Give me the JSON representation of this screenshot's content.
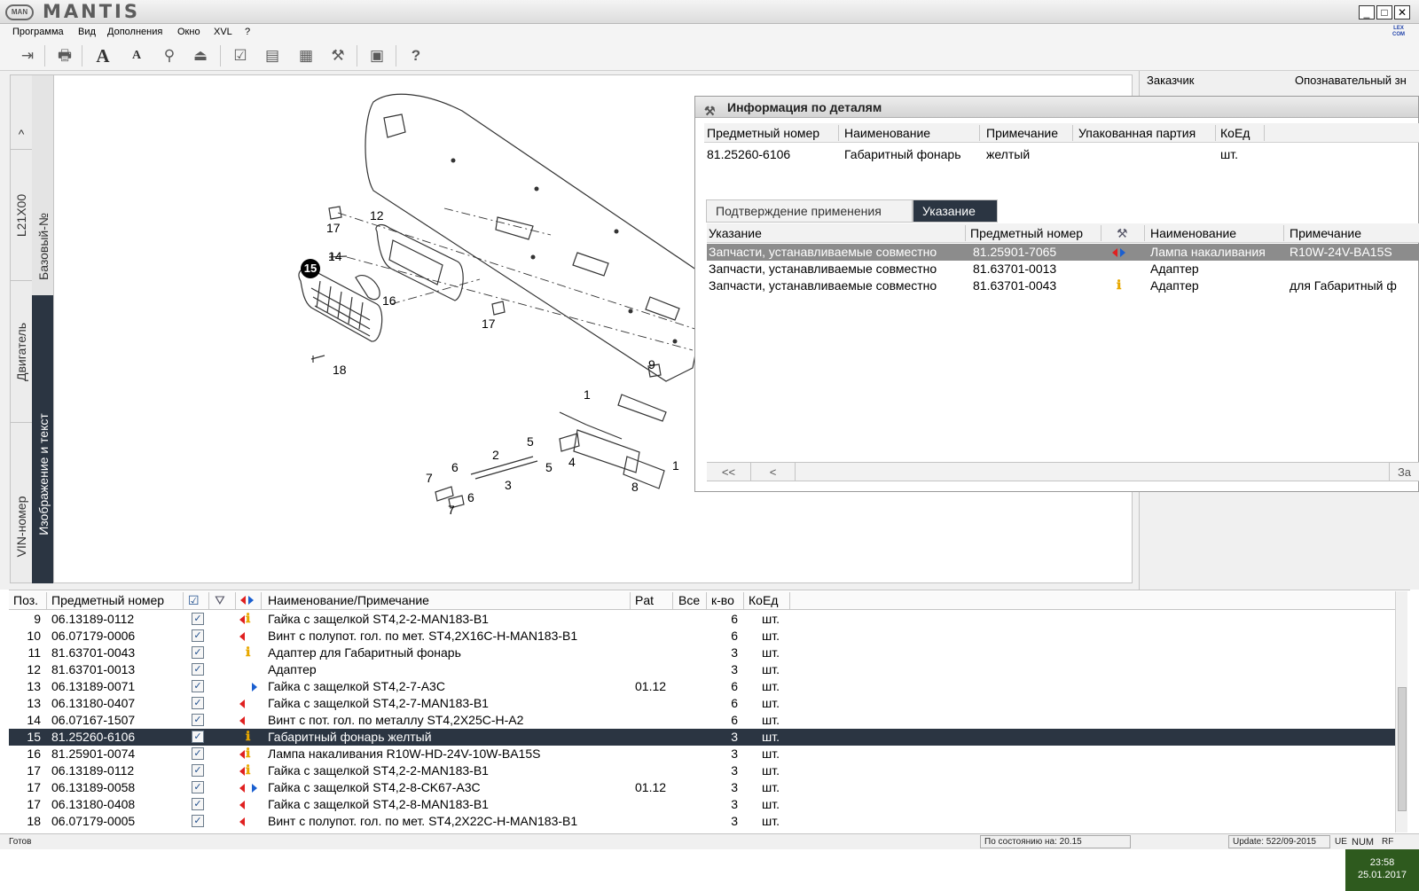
{
  "app": {
    "title": "MANTIS",
    "logo": "MAN"
  },
  "menu": [
    "Программа",
    "Вид",
    "Дополнения",
    "Окно",
    "XVL",
    "?"
  ],
  "menu_logo": "LEX COM",
  "toolbar_icons": [
    "exit-icon",
    "print-icon",
    "font-large-icon",
    "font-small-icon",
    "zoom-icon",
    "stamp-icon",
    "checklist-icon",
    "document-icon",
    "folder-icon",
    "tools-icon",
    "image-icon",
    "help-icon"
  ],
  "vtabs": {
    "up_arrow": "^",
    "model": "L21X00",
    "base_no": "Базовый-№",
    "engine": "Двигатель",
    "image_text": "Изображение и текст",
    "vin": "VIN-номер"
  },
  "callouts": [
    "17",
    "12",
    "14",
    "15",
    "16",
    "17",
    "18",
    "9",
    "1",
    "2",
    "5",
    "4",
    "5",
    "6",
    "6",
    "3",
    "7",
    "7",
    "8",
    "1"
  ],
  "right_panel": {
    "customer_label": "Заказчик",
    "id_label": "Опознавательный зн"
  },
  "info_window": {
    "title": "Информация по деталям",
    "columns": [
      "Предметный номер",
      "Наименование",
      "Примечание",
      "Упакованная партия",
      "КоЕд"
    ],
    "row": {
      "part_no": "81.25260-6106",
      "name": "Габаритный фонарь",
      "note": "желтый",
      "pack": "",
      "unit": "шт."
    },
    "tabs": [
      "Подтверждение применения",
      "Указание"
    ],
    "active_tab": "Указание",
    "ind_columns": [
      "Указание",
      "Предметный номер",
      "Наименование",
      "Примечание"
    ],
    "ind_rows": [
      {
        "indication": "Запчасти, устанавливаемые совместно",
        "part_no": "81.25901-7065",
        "name": "Лампа накаливания",
        "note": "R10W-24V-BA15S",
        "marker": "arrows"
      },
      {
        "indication": "Запчасти, устанавливаемые совместно",
        "part_no": "81.63701-0013",
        "name": "Адаптер",
        "note": "",
        "marker": ""
      },
      {
        "indication": "Запчасти, устанавливаемые совместно",
        "part_no": "81.63701-0043",
        "name": "Адаптер",
        "note": "для Габаритный ф",
        "marker": "info"
      }
    ],
    "nav": [
      "<<",
      "<",
      "За"
    ]
  },
  "parts_table": {
    "columns": [
      "Поз.",
      "Предметный номер",
      "Наименование/Примечание",
      "Pat",
      "Все",
      "к-во",
      "КоЕд"
    ],
    "rows": [
      {
        "pos": "9",
        "part": "06.13189-0112",
        "mk": "li",
        "name": "Гайка с защелкой ST4,2-2-MAN183-B1",
        "pat": "",
        "qty": "6",
        "unit": "шт."
      },
      {
        "pos": "10",
        "part": "06.07179-0006",
        "mk": "l",
        "name": "Винт с полупот. гол. по мет. ST4,2X16C-H-MAN183-B1",
        "pat": "",
        "qty": "6",
        "unit": "шт."
      },
      {
        "pos": "11",
        "part": "81.63701-0043",
        "mk": "i",
        "name": "Адаптер для Габаритный фонарь",
        "pat": "",
        "qty": "3",
        "unit": "шт."
      },
      {
        "pos": "12",
        "part": "81.63701-0013",
        "mk": "",
        "name": "Адаптер",
        "pat": "",
        "qty": "3",
        "unit": "шт."
      },
      {
        "pos": "13",
        "part": "06.13189-0071",
        "mk": "r",
        "name": "Гайка с защелкой ST4,2-7-A3C",
        "pat": "01.12",
        "qty": "6",
        "unit": "шт."
      },
      {
        "pos": "13",
        "part": "06.13180-0407",
        "mk": "l",
        "name": "Гайка с защелкой ST4,2-7-MAN183-B1",
        "pat": "",
        "qty": "6",
        "unit": "шт."
      },
      {
        "pos": "14",
        "part": "06.07167-1507",
        "mk": "l",
        "name": "Винт с пот. гол. по металлу ST4,2X25C-H-A2",
        "pat": "",
        "qty": "6",
        "unit": "шт."
      },
      {
        "pos": "15",
        "part": "81.25260-6106",
        "mk": "i",
        "name": "Габаритный фонарь желтый",
        "pat": "",
        "qty": "3",
        "unit": "шт.",
        "selected": true
      },
      {
        "pos": "16",
        "part": "81.25901-0074",
        "mk": "li",
        "name": "Лампа накаливания R10W-HD-24V-10W-BA15S",
        "pat": "",
        "qty": "3",
        "unit": "шт."
      },
      {
        "pos": "17",
        "part": "06.13189-0112",
        "mk": "li",
        "name": "Гайка с защелкой ST4,2-2-MAN183-B1",
        "pat": "",
        "qty": "3",
        "unit": "шт."
      },
      {
        "pos": "17",
        "part": "06.13189-0058",
        "mk": "lr",
        "name": "Гайка с защелкой ST4,2-8-CK67-A3C",
        "pat": "01.12",
        "qty": "3",
        "unit": "шт."
      },
      {
        "pos": "17",
        "part": "06.13180-0408",
        "mk": "l",
        "name": "Гайка с защелкой ST4,2-8-MAN183-B1",
        "pat": "",
        "qty": "3",
        "unit": "шт."
      },
      {
        "pos": "18",
        "part": "06.07179-0005",
        "mk": "l",
        "name": "Винт с полупот. гол. по мет. ST4,2X22C-H-MAN183-B1",
        "pat": "",
        "qty": "3",
        "unit": "шт."
      }
    ]
  },
  "status": {
    "ready": "Готов",
    "state_date": "По состоянию на: 20.15",
    "update": "Update: 522/09-2015",
    "flags": [
      "UE",
      "NUM",
      "RF"
    ]
  },
  "clock": {
    "time": "23:58",
    "date": "25.01.2017"
  },
  "colors": {
    "selection": "#2b3542",
    "arrow_left": "#e02020",
    "arrow_right": "#1a5fd0",
    "info": "#e8a800"
  }
}
